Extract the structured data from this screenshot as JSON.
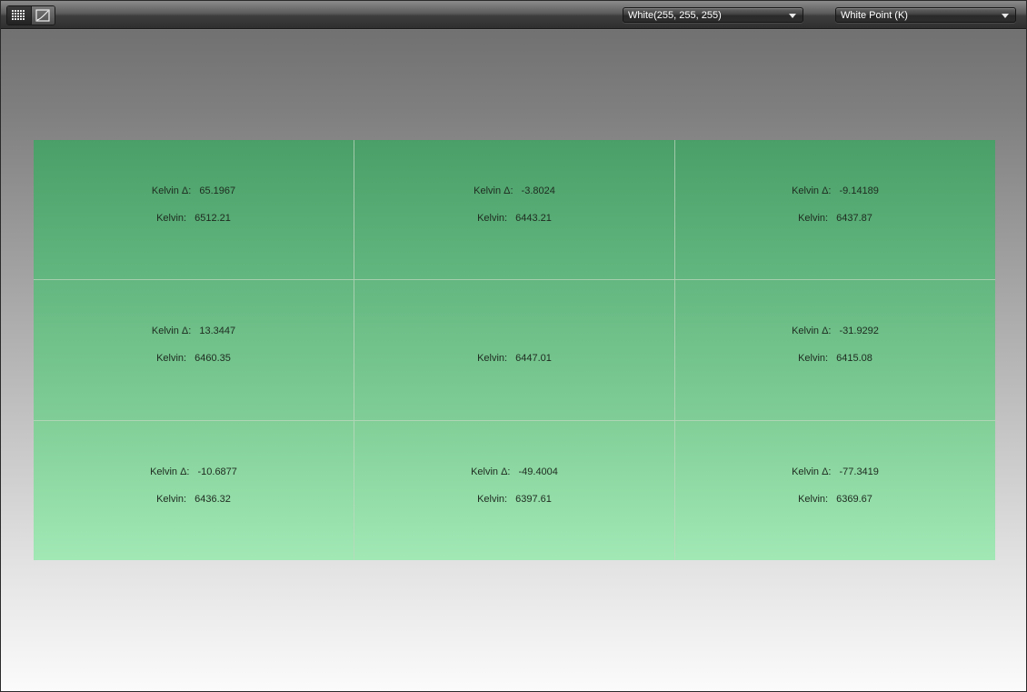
{
  "toolbar": {
    "view_modes": [
      {
        "name": "grid-view",
        "icon": "grid-icon",
        "selected": true
      },
      {
        "name": "curve-view",
        "icon": "curve-icon",
        "selected": false
      }
    ],
    "color_select": {
      "value": "White(255, 255, 255)"
    },
    "metric_select": {
      "value": "White Point (K)"
    }
  },
  "labels": {
    "delta": "Kelvin Δ:",
    "kelvin": "Kelvin:"
  },
  "cells": [
    {
      "delta": "65.1967",
      "kelvin": "6512.21"
    },
    {
      "delta": "-3.8024",
      "kelvin": "6443.21"
    },
    {
      "delta": "-9.14189",
      "kelvin": "6437.87"
    },
    {
      "delta": "13.3447",
      "kelvin": "6460.35"
    },
    {
      "delta": null,
      "kelvin": "6447.01"
    },
    {
      "delta": "-31.9292",
      "kelvin": "6415.08"
    },
    {
      "delta": "-10.6877",
      "kelvin": "6436.32"
    },
    {
      "delta": "-49.4004",
      "kelvin": "6397.61"
    },
    {
      "delta": "-77.3419",
      "kelvin": "6369.67"
    }
  ],
  "colors": {
    "cell_top": "#4a9f68",
    "cell_bottom": "#a1e8b5"
  }
}
